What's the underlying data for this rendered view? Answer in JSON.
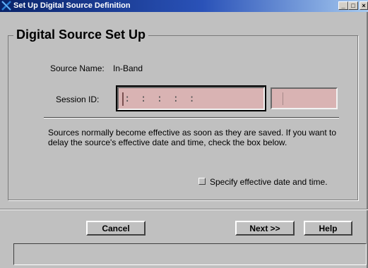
{
  "window": {
    "title": "Set Up Digital Source Definition",
    "buttons": {
      "minimize": "_",
      "maximize": "□",
      "close": "×"
    }
  },
  "group": {
    "title": "Digital Source Set Up"
  },
  "source": {
    "label": "Source Name:",
    "value": "In-Band"
  },
  "session": {
    "label": "Session ID:",
    "value": ": : : : :",
    "secondary_value": ""
  },
  "info_text": "Sources normally become effective as soon as they are saved.  If you want to delay the source's effective date and time, check the box below.",
  "checkbox": {
    "label": "Specify effective date and time.",
    "checked": false
  },
  "buttons": {
    "cancel": "Cancel",
    "next": "Next >>",
    "help": "Help"
  },
  "status": {
    "text": ""
  },
  "colors": {
    "window_bg": "#c0c0c0",
    "field_bg": "#d9b3b3",
    "titlebar_start": "#0a246a",
    "titlebar_end": "#a6caf0"
  },
  "icons": {
    "app": "x-logo-icon"
  }
}
